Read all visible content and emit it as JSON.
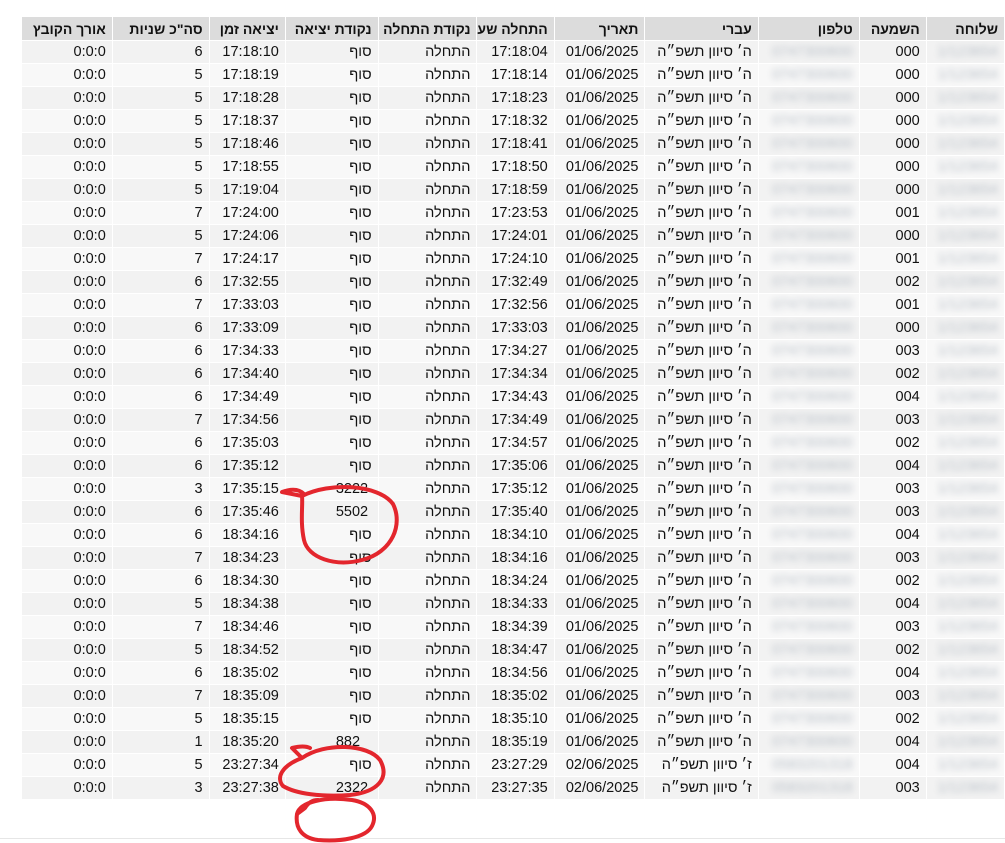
{
  "headers": [
    "שלוחה",
    "השמעה",
    "טלפון",
    "עברי",
    "תאריך",
    "התחלה שעה",
    "נקודת התחלה",
    "נקודת יציאה",
    "יציאה זמן",
    "סה\"כ שניות",
    "אורך הקובץ"
  ],
  "ext_placeholder": "1/123654",
  "rows": [
    {
      "play": "000",
      "phone": "0747300600",
      "heb": "ה׳ סיוון תשפ״ה",
      "date": "01/06/2025",
      "start": "17:18:04",
      "spoint": "התחלה",
      "epoint": "סוף",
      "etime": "17:18:10",
      "secs": "6",
      "len": "0:0:0"
    },
    {
      "play": "000",
      "phone": "0747300600",
      "heb": "ה׳ סיוון תשפ״ה",
      "date": "01/06/2025",
      "start": "17:18:14",
      "spoint": "התחלה",
      "epoint": "סוף",
      "etime": "17:18:19",
      "secs": "5",
      "len": "0:0:0"
    },
    {
      "play": "000",
      "phone": "0747300600",
      "heb": "ה׳ סיוון תשפ״ה",
      "date": "01/06/2025",
      "start": "17:18:23",
      "spoint": "התחלה",
      "epoint": "סוף",
      "etime": "17:18:28",
      "secs": "5",
      "len": "0:0:0"
    },
    {
      "play": "000",
      "phone": "0747300600",
      "heb": "ה׳ סיוון תשפ״ה",
      "date": "01/06/2025",
      "start": "17:18:32",
      "spoint": "התחלה",
      "epoint": "סוף",
      "etime": "17:18:37",
      "secs": "5",
      "len": "0:0:0"
    },
    {
      "play": "000",
      "phone": "0747300600",
      "heb": "ה׳ סיוון תשפ״ה",
      "date": "01/06/2025",
      "start": "17:18:41",
      "spoint": "התחלה",
      "epoint": "סוף",
      "etime": "17:18:46",
      "secs": "5",
      "len": "0:0:0"
    },
    {
      "play": "000",
      "phone": "0747300600",
      "heb": "ה׳ סיוון תשפ״ה",
      "date": "01/06/2025",
      "start": "17:18:50",
      "spoint": "התחלה",
      "epoint": "סוף",
      "etime": "17:18:55",
      "secs": "5",
      "len": "0:0:0"
    },
    {
      "play": "000",
      "phone": "0747300600",
      "heb": "ה׳ סיוון תשפ״ה",
      "date": "01/06/2025",
      "start": "17:18:59",
      "spoint": "התחלה",
      "epoint": "סוף",
      "etime": "17:19:04",
      "secs": "5",
      "len": "0:0:0"
    },
    {
      "play": "001",
      "phone": "0747300600",
      "heb": "ה׳ סיוון תשפ״ה",
      "date": "01/06/2025",
      "start": "17:23:53",
      "spoint": "התחלה",
      "epoint": "סוף",
      "etime": "17:24:00",
      "secs": "7",
      "len": "0:0:0"
    },
    {
      "play": "000",
      "phone": "0747300600",
      "heb": "ה׳ סיוון תשפ״ה",
      "date": "01/06/2025",
      "start": "17:24:01",
      "spoint": "התחלה",
      "epoint": "סוף",
      "etime": "17:24:06",
      "secs": "5",
      "len": "0:0:0"
    },
    {
      "play": "001",
      "phone": "0747300600",
      "heb": "ה׳ סיוון תשפ״ה",
      "date": "01/06/2025",
      "start": "17:24:10",
      "spoint": "התחלה",
      "epoint": "סוף",
      "etime": "17:24:17",
      "secs": "7",
      "len": "0:0:0"
    },
    {
      "play": "002",
      "phone": "0747300600",
      "heb": "ה׳ סיוון תשפ״ה",
      "date": "01/06/2025",
      "start": "17:32:49",
      "spoint": "התחלה",
      "epoint": "סוף",
      "etime": "17:32:55",
      "secs": "6",
      "len": "0:0:0"
    },
    {
      "play": "001",
      "phone": "0747300600",
      "heb": "ה׳ סיוון תשפ״ה",
      "date": "01/06/2025",
      "start": "17:32:56",
      "spoint": "התחלה",
      "epoint": "סוף",
      "etime": "17:33:03",
      "secs": "7",
      "len": "0:0:0"
    },
    {
      "play": "000",
      "phone": "0747300600",
      "heb": "ה׳ סיוון תשפ״ה",
      "date": "01/06/2025",
      "start": "17:33:03",
      "spoint": "התחלה",
      "epoint": "סוף",
      "etime": "17:33:09",
      "secs": "6",
      "len": "0:0:0"
    },
    {
      "play": "003",
      "phone": "0747300600",
      "heb": "ה׳ סיוון תשפ״ה",
      "date": "01/06/2025",
      "start": "17:34:27",
      "spoint": "התחלה",
      "epoint": "סוף",
      "etime": "17:34:33",
      "secs": "6",
      "len": "0:0:0"
    },
    {
      "play": "002",
      "phone": "0747300600",
      "heb": "ה׳ סיוון תשפ״ה",
      "date": "01/06/2025",
      "start": "17:34:34",
      "spoint": "התחלה",
      "epoint": "סוף",
      "etime": "17:34:40",
      "secs": "6",
      "len": "0:0:0"
    },
    {
      "play": "004",
      "phone": "0747300600",
      "heb": "ה׳ סיוון תשפ״ה",
      "date": "01/06/2025",
      "start": "17:34:43",
      "spoint": "התחלה",
      "epoint": "סוף",
      "etime": "17:34:49",
      "secs": "6",
      "len": "0:0:0"
    },
    {
      "play": "003",
      "phone": "0747300600",
      "heb": "ה׳ סיוון תשפ״ה",
      "date": "01/06/2025",
      "start": "17:34:49",
      "spoint": "התחלה",
      "epoint": "סוף",
      "etime": "17:34:56",
      "secs": "7",
      "len": "0:0:0"
    },
    {
      "play": "002",
      "phone": "0747300600",
      "heb": "ה׳ סיוון תשפ״ה",
      "date": "01/06/2025",
      "start": "17:34:57",
      "spoint": "התחלה",
      "epoint": "סוף",
      "etime": "17:35:03",
      "secs": "6",
      "len": "0:0:0"
    },
    {
      "play": "004",
      "phone": "0747300600",
      "heb": "ה׳ סיוון תשפ״ה",
      "date": "01/06/2025",
      "start": "17:35:06",
      "spoint": "התחלה",
      "epoint": "סוף",
      "etime": "17:35:12",
      "secs": "6",
      "len": "0:0:0"
    },
    {
      "play": "003",
      "phone": "0747300600",
      "heb": "ה׳ סיוון תשפ״ה",
      "date": "01/06/2025",
      "start": "17:35:12",
      "spoint": "התחלה",
      "epoint": "3222",
      "etime": "17:35:15",
      "secs": "3",
      "len": "0:0:0"
    },
    {
      "play": "003",
      "phone": "0747300600",
      "heb": "ה׳ סיוון תשפ״ה",
      "date": "01/06/2025",
      "start": "17:35:40",
      "spoint": "התחלה",
      "epoint": "5502",
      "etime": "17:35:46",
      "secs": "6",
      "len": "0:0:0"
    },
    {
      "play": "004",
      "phone": "0747300600",
      "heb": "ה׳ סיוון תשפ״ה",
      "date": "01/06/2025",
      "start": "18:34:10",
      "spoint": "התחלה",
      "epoint": "סוף",
      "etime": "18:34:16",
      "secs": "6",
      "len": "0:0:0"
    },
    {
      "play": "003",
      "phone": "0747300600",
      "heb": "ה׳ סיוון תשפ״ה",
      "date": "01/06/2025",
      "start": "18:34:16",
      "spoint": "התחלה",
      "epoint": "סוף",
      "etime": "18:34:23",
      "secs": "7",
      "len": "0:0:0"
    },
    {
      "play": "002",
      "phone": "0747300600",
      "heb": "ה׳ סיוון תשפ״ה",
      "date": "01/06/2025",
      "start": "18:34:24",
      "spoint": "התחלה",
      "epoint": "סוף",
      "etime": "18:34:30",
      "secs": "6",
      "len": "0:0:0"
    },
    {
      "play": "004",
      "phone": "0747300600",
      "heb": "ה׳ סיוון תשפ״ה",
      "date": "01/06/2025",
      "start": "18:34:33",
      "spoint": "התחלה",
      "epoint": "סוף",
      "etime": "18:34:38",
      "secs": "5",
      "len": "0:0:0"
    },
    {
      "play": "003",
      "phone": "0747300600",
      "heb": "ה׳ סיוון תשפ״ה",
      "date": "01/06/2025",
      "start": "18:34:39",
      "spoint": "התחלה",
      "epoint": "סוף",
      "etime": "18:34:46",
      "secs": "7",
      "len": "0:0:0"
    },
    {
      "play": "002",
      "phone": "0747300600",
      "heb": "ה׳ סיוון תשפ״ה",
      "date": "01/06/2025",
      "start": "18:34:47",
      "spoint": "התחלה",
      "epoint": "סוף",
      "etime": "18:34:52",
      "secs": "5",
      "len": "0:0:0"
    },
    {
      "play": "004",
      "phone": "0747300600",
      "heb": "ה׳ סיוון תשפ״ה",
      "date": "01/06/2025",
      "start": "18:34:56",
      "spoint": "התחלה",
      "epoint": "סוף",
      "etime": "18:35:02",
      "secs": "6",
      "len": "0:0:0"
    },
    {
      "play": "003",
      "phone": "0747300600",
      "heb": "ה׳ סיוון תשפ״ה",
      "date": "01/06/2025",
      "start": "18:35:02",
      "spoint": "התחלה",
      "epoint": "סוף",
      "etime": "18:35:09",
      "secs": "7",
      "len": "0:0:0"
    },
    {
      "play": "002",
      "phone": "0747300600",
      "heb": "ה׳ סיוון תשפ״ה",
      "date": "01/06/2025",
      "start": "18:35:10",
      "spoint": "התחלה",
      "epoint": "סוף",
      "etime": "18:35:15",
      "secs": "5",
      "len": "0:0:0"
    },
    {
      "play": "004",
      "phone": "0747300600",
      "heb": "ה׳ סיוון תשפ״ה",
      "date": "01/06/2025",
      "start": "18:35:19",
      "spoint": "התחלה",
      "epoint": "882",
      "etime": "18:35:20",
      "secs": "1",
      "len": "0:0:0"
    },
    {
      "play": "004",
      "phone": "0583201318",
      "heb": "ז׳ סיוון תשפ״ה",
      "date": "02/06/2025",
      "start": "23:27:29",
      "spoint": "התחלה",
      "epoint": "סוף",
      "etime": "23:27:34",
      "secs": "5",
      "len": "0:0:0"
    },
    {
      "play": "003",
      "phone": "0583201318",
      "heb": "ז׳ סיוון תשפ״ה",
      "date": "02/06/2025",
      "start": "23:27:35",
      "spoint": "התחלה",
      "epoint": "2322",
      "etime": "23:27:38",
      "secs": "3",
      "len": "0:0:0"
    }
  ],
  "colors": {
    "header_bg": "#dcdcdc",
    "row_bg": "#f2f2f2",
    "annotation": "#e3262d"
  }
}
